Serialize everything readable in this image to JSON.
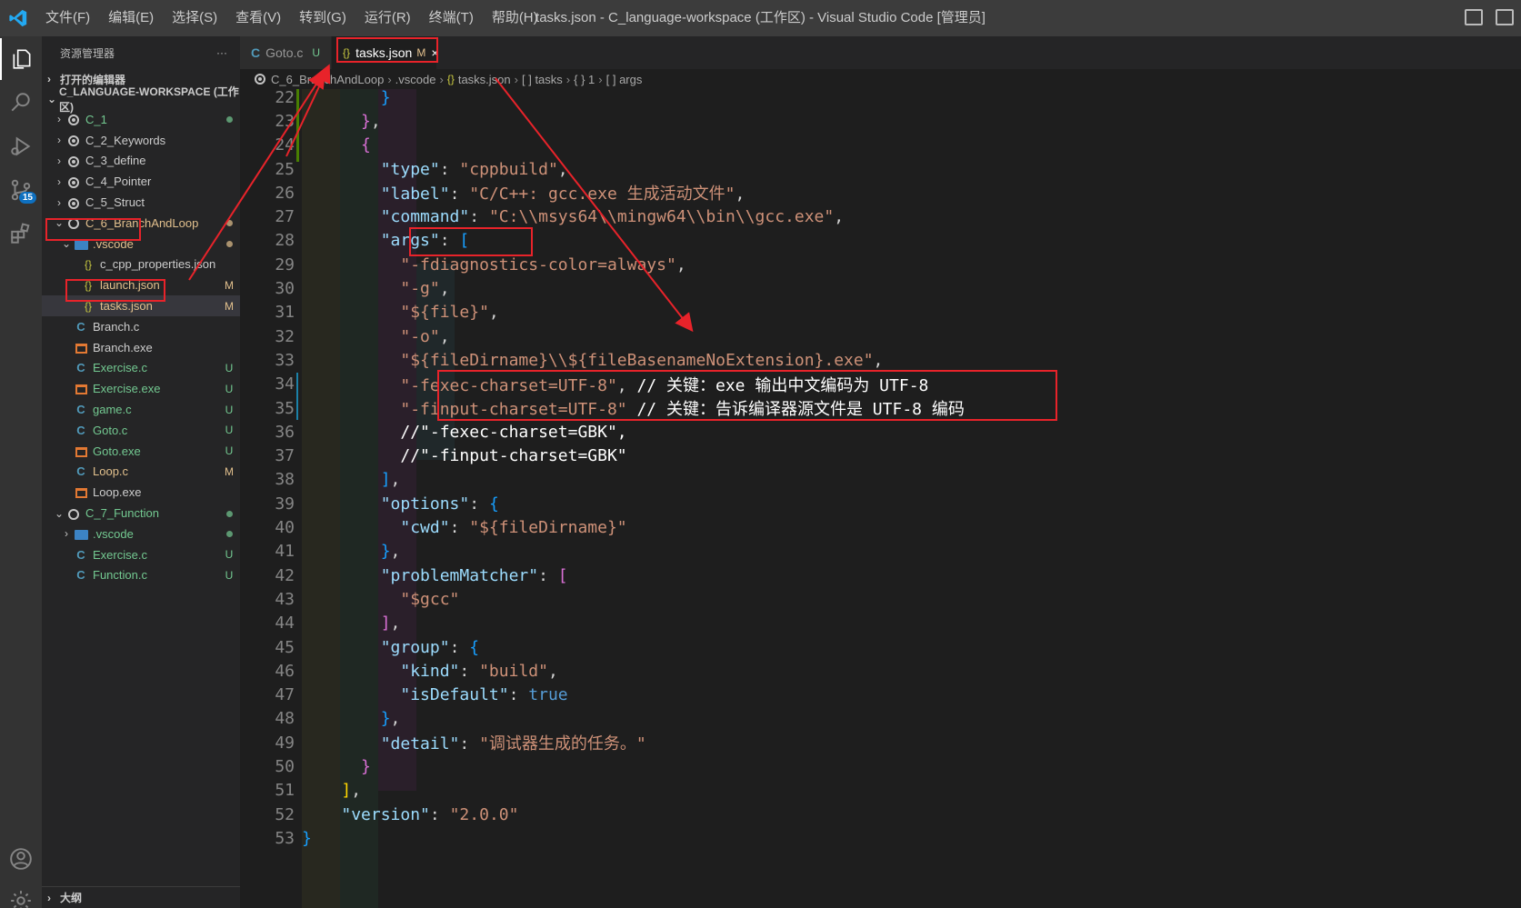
{
  "window": {
    "title": "tasks.json - C_language-workspace (工作区) - Visual Studio Code [管理员]",
    "menu": [
      "文件(F)",
      "编辑(E)",
      "选择(S)",
      "查看(V)",
      "转到(G)",
      "运行(R)",
      "终端(T)",
      "帮助(H)"
    ]
  },
  "activity": {
    "scm_badge": "15"
  },
  "sidebar": {
    "title": "资源管理器",
    "more": "···",
    "open_editors": "打开的编辑器",
    "workspace": "C_LANGUAGE-WORKSPACE (工作区)",
    "outline": "大纲",
    "items": [
      {
        "label": "C_1",
        "status": "dot",
        "color": "#73c991"
      },
      {
        "label": "C_2_Keywords",
        "status": "",
        "color": "#cccccc"
      },
      {
        "label": "C_3_define",
        "status": "",
        "color": "#cccccc"
      },
      {
        "label": "C_4_Pointer",
        "status": "",
        "color": "#cccccc"
      },
      {
        "label": "C_5_Struct",
        "status": "",
        "color": "#cccccc"
      },
      {
        "label": "C_6_BranchAndLoop",
        "status": "dot",
        "color": "#e2c08d"
      },
      {
        "label": ".vscode",
        "status": "dot",
        "color": "#e2c08d"
      },
      {
        "label": "c_cpp_properties.json",
        "status": "",
        "color": "#cccccc"
      },
      {
        "label": "launch.json",
        "status": "M",
        "color": "#e2c08d"
      },
      {
        "label": "tasks.json",
        "status": "M",
        "color": "#e2c08d"
      },
      {
        "label": "Branch.c",
        "status": "",
        "color": "#cccccc"
      },
      {
        "label": "Branch.exe",
        "status": "",
        "color": "#cccccc"
      },
      {
        "label": "Exercise.c",
        "status": "U",
        "color": "#73c991"
      },
      {
        "label": "Exercise.exe",
        "status": "U",
        "color": "#73c991"
      },
      {
        "label": "game.c",
        "status": "U",
        "color": "#73c991"
      },
      {
        "label": "Goto.c",
        "status": "U",
        "color": "#73c991"
      },
      {
        "label": "Goto.exe",
        "status": "U",
        "color": "#73c991"
      },
      {
        "label": "Loop.c",
        "status": "M",
        "color": "#e2c08d"
      },
      {
        "label": "Loop.exe",
        "status": "",
        "color": "#cccccc"
      },
      {
        "label": "C_7_Function",
        "status": "dot",
        "color": "#73c991"
      },
      {
        "label": ".vscode",
        "status": "dot",
        "color": "#73c991"
      },
      {
        "label": "Exercise.c",
        "status": "U",
        "color": "#73c991"
      },
      {
        "label": "Function.c",
        "status": "U",
        "color": "#73c991"
      }
    ]
  },
  "tabs": [
    {
      "label": "Goto.c",
      "status": "U"
    },
    {
      "label": "tasks.json",
      "status": "M",
      "close": "×"
    }
  ],
  "breadcrumb": [
    "C_6_BranchAndLoop",
    ".vscode",
    "tasks.json",
    "[ ] tasks",
    "{ } 1",
    "[ ] args"
  ],
  "colors": {
    "accent": "#007acc",
    "annotation": "#e8232a"
  }
}
